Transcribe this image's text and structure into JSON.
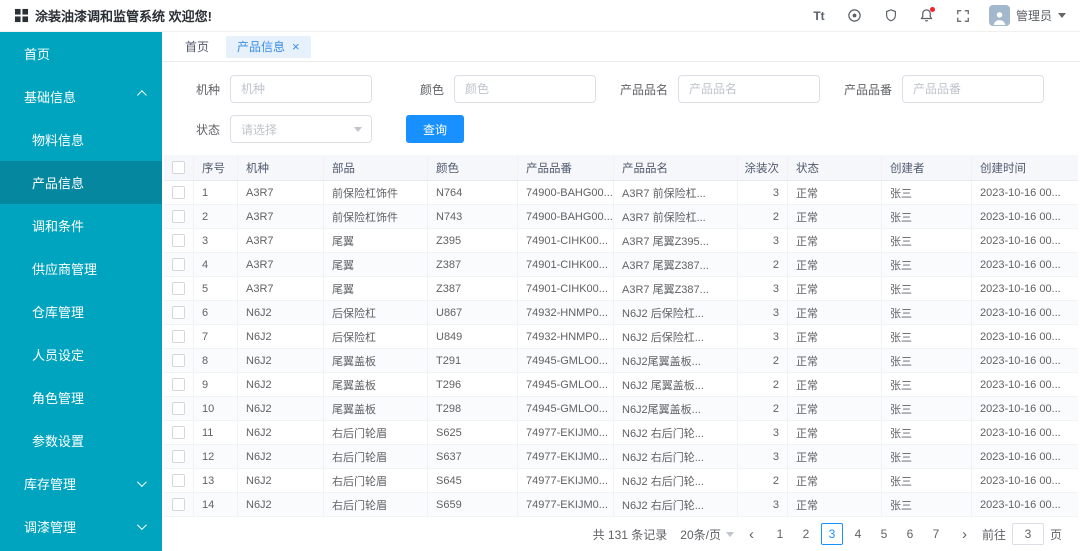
{
  "colors": {
    "sidebar": "#00a4be",
    "sidebar_active": "#0687a0",
    "primary": "#1890ff",
    "tab_active_bg": "#e6f1fc"
  },
  "header": {
    "title": "涂装油漆调和监管系统 欢迎您!",
    "font_size_icon_text": "Tt",
    "right_icons": [
      "font-size-icon",
      "theme-icon",
      "badge-icon",
      "bell-icon",
      "fullscreen-icon"
    ],
    "user": "管理员"
  },
  "sidebar": {
    "items": [
      {
        "label": "首页",
        "type": "item"
      },
      {
        "label": "基础信息",
        "type": "group",
        "expanded": true
      },
      {
        "label": "物料信息",
        "type": "sub"
      },
      {
        "label": "产品信息",
        "type": "sub",
        "active": true
      },
      {
        "label": "调和条件",
        "type": "sub"
      },
      {
        "label": "供应商管理",
        "type": "sub"
      },
      {
        "label": "仓库管理",
        "type": "sub"
      },
      {
        "label": "人员设定",
        "type": "sub"
      },
      {
        "label": "角色管理",
        "type": "sub"
      },
      {
        "label": "参数设置",
        "type": "sub"
      },
      {
        "label": "库存管理",
        "type": "group",
        "expanded": false
      },
      {
        "label": "调漆管理",
        "type": "group",
        "expanded": false
      }
    ]
  },
  "tabs": [
    {
      "label": "首页",
      "active": false,
      "closable": false
    },
    {
      "label": "产品信息",
      "active": true,
      "closable": true
    }
  ],
  "search": {
    "fields": [
      {
        "label": "机种",
        "placeholder": "机种"
      },
      {
        "label": "颜色",
        "placeholder": "颜色"
      },
      {
        "label": "产品品名",
        "placeholder": "产品品名"
      },
      {
        "label": "产品品番",
        "placeholder": "产品品番"
      },
      {
        "label": "状态",
        "placeholder": "请选择"
      }
    ],
    "query_button": "查询"
  },
  "table": {
    "columns": [
      "序号",
      "机种",
      "部品",
      "颜色",
      "产品品番",
      "产品品名",
      "涂装次",
      "状态",
      "创建者",
      "创建时间"
    ],
    "rows": [
      [
        "1",
        "A3R7",
        "前保险杠饰件",
        "N764",
        "74900-BAHG00...",
        "A3R7 前保险杠...",
        "3",
        "正常",
        "张三",
        "2023-10-16 00..."
      ],
      [
        "2",
        "A3R7",
        "前保险杠饰件",
        "N743",
        "74900-BAHG00...",
        "A3R7 前保险杠...",
        "2",
        "正常",
        "张三",
        "2023-10-16 00..."
      ],
      [
        "3",
        "A3R7",
        "尾翼",
        "Z395",
        "74901-CIHK00...",
        "A3R7 尾翼Z395...",
        "3",
        "正常",
        "张三",
        "2023-10-16 00..."
      ],
      [
        "4",
        "A3R7",
        "尾翼",
        "Z387",
        "74901-CIHK00...",
        "A3R7 尾翼Z387...",
        "2",
        "正常",
        "张三",
        "2023-10-16 00..."
      ],
      [
        "5",
        "A3R7",
        "尾翼",
        "Z387",
        "74901-CIHK00...",
        "A3R7 尾翼Z387...",
        "3",
        "正常",
        "张三",
        "2023-10-16 00..."
      ],
      [
        "6",
        "N6J2",
        "后保险杠",
        "U867",
        "74932-HNMP0...",
        "N6J2 后保险杠...",
        "3",
        "正常",
        "张三",
        "2023-10-16 00..."
      ],
      [
        "7",
        "N6J2",
        "后保险杠",
        "U849",
        "74932-HNMP0...",
        "N6J2 后保险杠...",
        "3",
        "正常",
        "张三",
        "2023-10-16 00..."
      ],
      [
        "8",
        "N6J2",
        "尾翼盖板",
        "T291",
        "74945-GMLO0...",
        "N6J2尾翼盖板...",
        "2",
        "正常",
        "张三",
        "2023-10-16 00..."
      ],
      [
        "9",
        "N6J2",
        "尾翼盖板",
        "T296",
        "74945-GMLO0...",
        "N6J2 尾翼盖板...",
        "2",
        "正常",
        "张三",
        "2023-10-16 00..."
      ],
      [
        "10",
        "N6J2",
        "尾翼盖板",
        "T298",
        "74945-GMLO0...",
        "N6J2尾翼盖板...",
        "2",
        "正常",
        "张三",
        "2023-10-16 00..."
      ],
      [
        "11",
        "N6J2",
        "右后门轮眉",
        "S625",
        "74977-EKIJM0...",
        "N6J2 右后门轮...",
        "3",
        "正常",
        "张三",
        "2023-10-16 00..."
      ],
      [
        "12",
        "N6J2",
        "右后门轮眉",
        "S637",
        "74977-EKIJM0...",
        "N6J2 右后门轮...",
        "3",
        "正常",
        "张三",
        "2023-10-16 00..."
      ],
      [
        "13",
        "N6J2",
        "右后门轮眉",
        "S645",
        "74977-EKIJM0...",
        "N6J2 右后门轮...",
        "2",
        "正常",
        "张三",
        "2023-10-16 00..."
      ],
      [
        "14",
        "N6J2",
        "右后门轮眉",
        "S659",
        "74977-EKIJM0...",
        "N6J2 右后门轮...",
        "3",
        "正常",
        "张三",
        "2023-10-16 00..."
      ]
    ]
  },
  "pagination": {
    "total_text": "共 131 条记录",
    "page_size": "20条/页",
    "prev": "‹",
    "next": "›",
    "pages": [
      "1",
      "2",
      "3",
      "4",
      "5",
      "6",
      "7"
    ],
    "current_page": "3",
    "goto_label": "前往",
    "goto_value": "3",
    "goto_suffix": "页"
  }
}
